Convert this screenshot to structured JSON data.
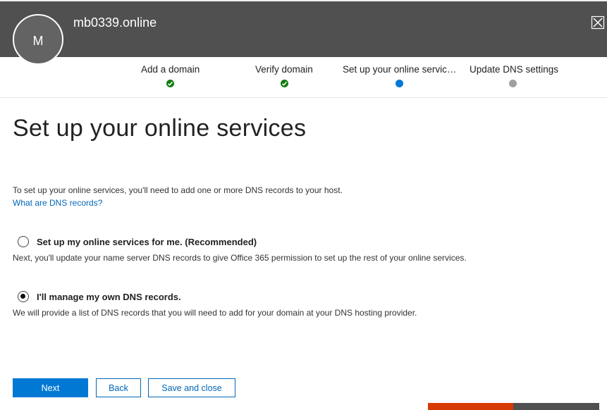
{
  "header": {
    "avatar_initial": "M",
    "site_name": "mb0339.online"
  },
  "steps": [
    {
      "label": "Add a domain",
      "status": "done"
    },
    {
      "label": "Verify domain",
      "status": "done"
    },
    {
      "label": "Set up your online servic…",
      "status": "current"
    },
    {
      "label": "Update DNS settings",
      "status": "pending"
    }
  ],
  "page": {
    "title": "Set up your online services",
    "intro": "To set up your online services, you'll need to add one or more DNS records to your host.",
    "link": "What are DNS records?"
  },
  "options": [
    {
      "label": "Set up my online services for me. (Recommended)",
      "description": "Next, you'll update your name server DNS records to give Office 365 permission to set up the rest of your online services.",
      "selected": false
    },
    {
      "label": "I'll manage my own DNS records.",
      "description": "We will provide a list of DNS records that you will need to add for your domain at your DNS hosting provider.",
      "selected": true
    }
  ],
  "buttons": {
    "next": "Next",
    "back": "Back",
    "save_close": "Save and close"
  },
  "colors": {
    "header_bg": "#505050",
    "accent": "#0078d4",
    "done": "#107c10",
    "pending": "#a0a0a0",
    "link": "#0067b8"
  }
}
